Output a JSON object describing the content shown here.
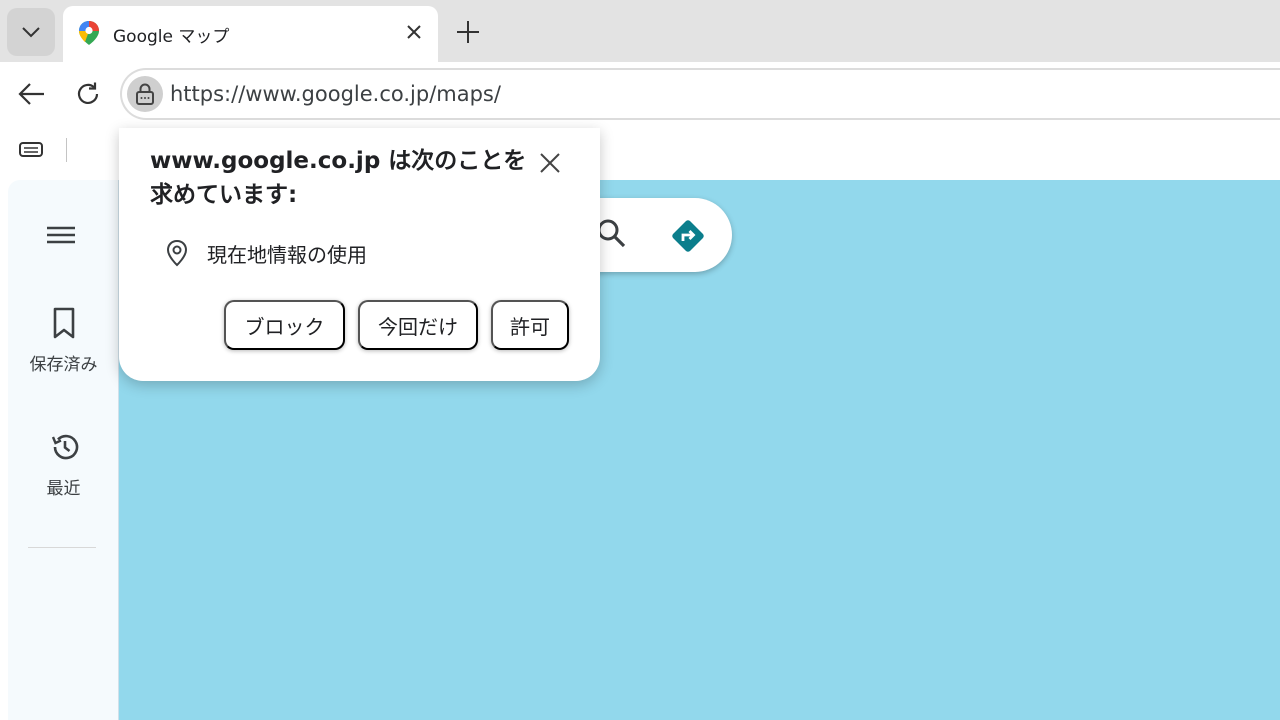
{
  "tab": {
    "title": "Google マップ"
  },
  "toolbar": {
    "url": "https://www.google.co.jp/maps/"
  },
  "sidebar": {
    "saved_label": "保存済み",
    "recent_label": "最近"
  },
  "permission_popup": {
    "title": "www.google.co.jp は次のことを求めています:",
    "permission": "現在地情報の使用",
    "block_label": "ブロック",
    "once_label": "今回だけ",
    "allow_label": "許可"
  },
  "icons": {
    "tab_list": "chevron-down-icon",
    "favicon": "google-maps-pin-icon",
    "tab_close": "close-icon",
    "new_tab": "plus-icon",
    "back": "arrow-left-icon",
    "reload": "reload-icon",
    "site_info": "lock-icon",
    "bookmark_bar_item": "tab-group-icon",
    "menu": "hamburger-menu-icon",
    "saved": "bookmark-icon",
    "recent": "history-icon",
    "search": "search-icon",
    "directions": "directions-icon",
    "popup_close": "close-icon",
    "location": "location-pin-icon"
  },
  "colors": {
    "map_water": "#92d8ec",
    "directions": "#0b7e8c",
    "tabstrip": "#e3e3e3"
  }
}
